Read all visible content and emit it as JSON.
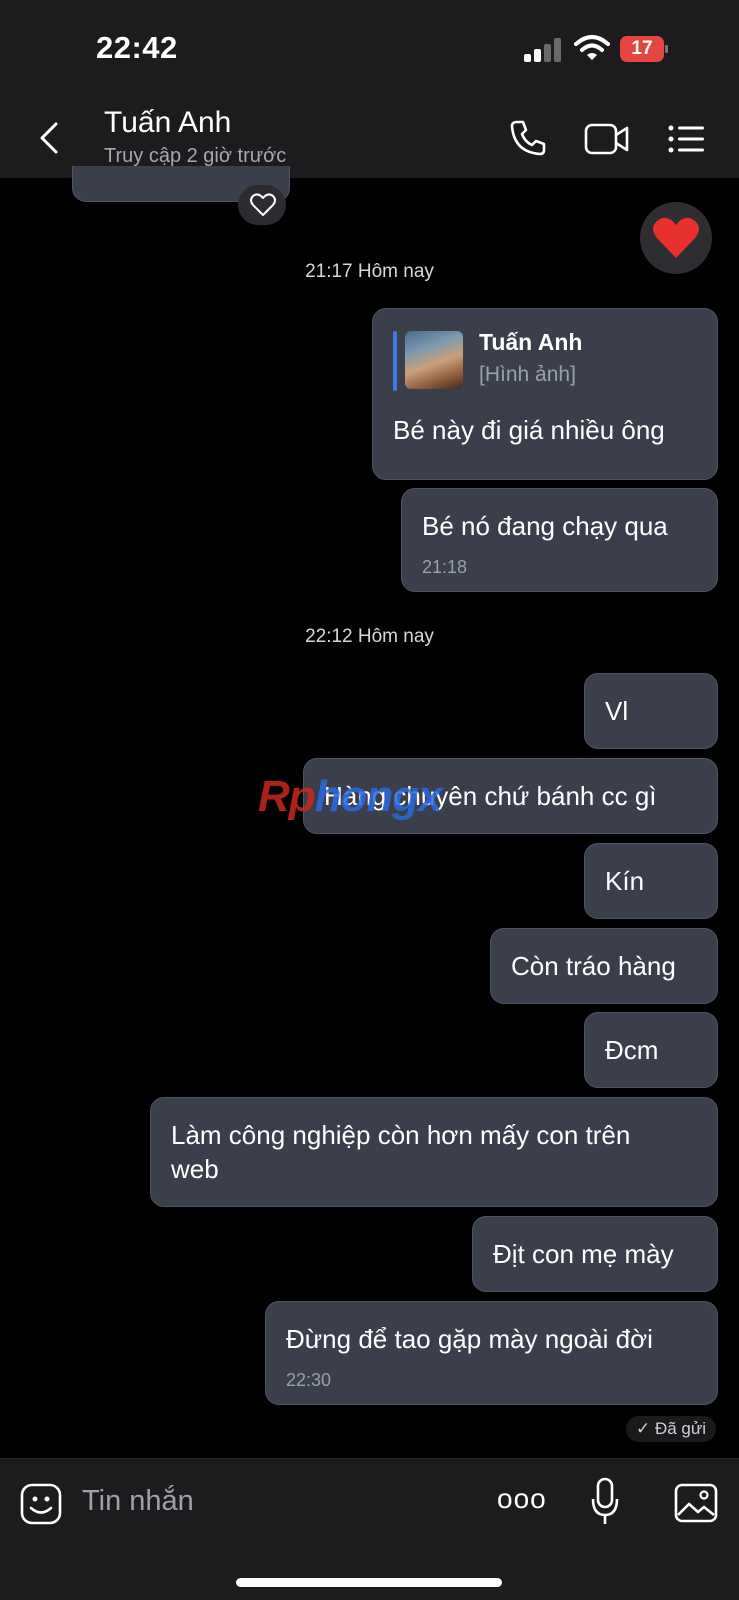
{
  "status_bar": {
    "time": "22:42",
    "battery": "17"
  },
  "header": {
    "contact_name": "Tuấn Anh",
    "contact_status": "Truy cập 2 giờ trước",
    "icons": [
      "back-icon",
      "phone-icon",
      "video-call-icon",
      "menu-icon"
    ]
  },
  "dividers": [
    "21:17 Hôm nay",
    "22:12 Hôm nay"
  ],
  "reply_quote": {
    "name": "Tuấn Anh",
    "sub": "[Hình ảnh]"
  },
  "messages": [
    {
      "text": "Bé này đi giá nhiều ông"
    },
    {
      "text": "Bé nó đang chạy qua",
      "time": "21:18"
    },
    {
      "text": "Vl"
    },
    {
      "text": "Hàng chuyên chứ bánh cc gì"
    },
    {
      "text": "Kín"
    },
    {
      "text": "Còn tráo hàng"
    },
    {
      "text": "Đcm"
    },
    {
      "line1": "Làm công nghiệp còn hơn mấy con trên",
      "line2": "web"
    },
    {
      "text": "Địt con mẹ mày"
    },
    {
      "text": "Đừng để tao gặp mày ngoài đời",
      "time": "22:30"
    }
  ],
  "sent_status": "✓ Đã gửi",
  "watermark": {
    "part1": "Rp",
    "part2": "hongx"
  },
  "composer": {
    "placeholder": "Tin nhắn",
    "more_label": "ooo",
    "icons": [
      "sticker-icon",
      "more-icon",
      "microphone-icon",
      "image-icon"
    ]
  },
  "colors": {
    "bubble": "#3a3f4b",
    "header": "#1c1c1e",
    "battery": "#e5453f",
    "heart": "#e8302d",
    "quote_bar": "#3b7be8"
  }
}
